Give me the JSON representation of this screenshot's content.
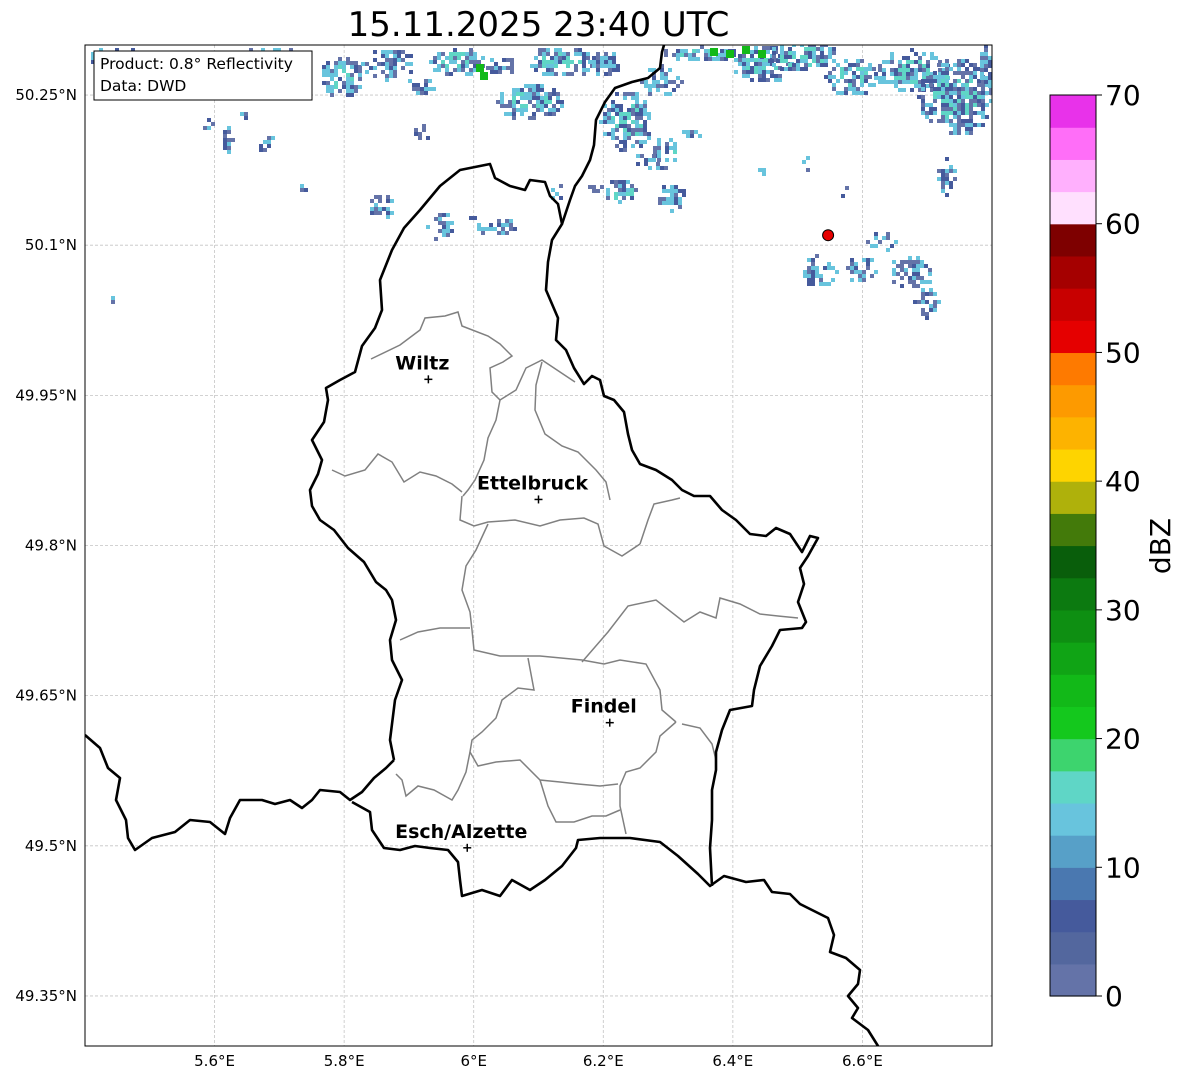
{
  "title": "15.11.2025 23:40 UTC",
  "info_box": {
    "product": "Product: 0.8° Reflectivity",
    "data": "Data: DWD"
  },
  "lat_ticks": [
    "50.25°N",
    "50.1°N",
    "49.95°N",
    "49.8°N",
    "49.65°N",
    "49.5°N",
    "49.35°N"
  ],
  "lon_ticks": [
    "5.6°E",
    "5.8°E",
    "6°E",
    "6.2°E",
    "6.4°E",
    "6.6°E"
  ],
  "cities": [
    {
      "name": "Wiltz",
      "lon": 5.93,
      "lat": 49.966
    },
    {
      "name": "Ettelbruck",
      "lon": 6.1,
      "lat": 49.846
    },
    {
      "name": "Findel",
      "lon": 6.21,
      "lat": 49.623
    },
    {
      "name": "Esch/Alzette",
      "lon": 5.99,
      "lat": 49.498
    }
  ],
  "radar_site": {
    "lon": 6.547,
    "lat": 50.11
  },
  "map_extent": {
    "lon": [
      5.4,
      6.8
    ],
    "lat": [
      49.3,
      50.3
    ]
  },
  "colorbar": {
    "label": "dBZ",
    "ticks": [
      "0",
      "10",
      "20",
      "30",
      "40",
      "50",
      "60",
      "70"
    ],
    "range": [
      0,
      70
    ],
    "colors": [
      "#6473a8",
      "#53679e",
      "#455a9c",
      "#4a78b0",
      "#57a0c8",
      "#68c4dd",
      "#5fd6c6",
      "#3dd46e",
      "#14c81d",
      "#12b918",
      "#10a415",
      "#0e8f12",
      "#0c7a10",
      "#095e0b",
      "#437a0a",
      "#afb10b",
      "#fed400",
      "#fdb300",
      "#fd9a00",
      "#fe7a00",
      "#e50000",
      "#c80000",
      "#a50000",
      "#7e0000",
      "#ffe0fe",
      "#ffb0fd",
      "#ff6ef8",
      "#e832ea"
    ]
  },
  "echo_color_dbz": [
    2,
    6,
    13,
    16,
    23
  ]
}
